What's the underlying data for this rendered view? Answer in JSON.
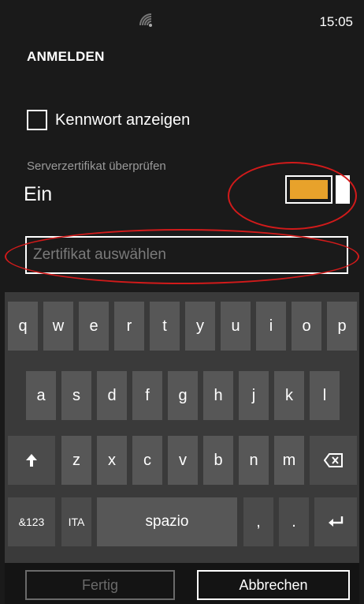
{
  "status": {
    "time": "15:05",
    "signal_icon": "wifi-signal-icon"
  },
  "page": {
    "title": "ANMELDEN"
  },
  "show_password": {
    "label": "Kennwort anzeigen",
    "checked": false
  },
  "server_cert": {
    "label": "Serverzertifikat überprüfen",
    "state": "Ein",
    "toggle_on": true,
    "accent": "#e8a22b"
  },
  "cert_field": {
    "placeholder": "Zertifikat auswählen",
    "value": ""
  },
  "keyboard": {
    "row1": [
      "q",
      "w",
      "e",
      "r",
      "t",
      "y",
      "u",
      "i",
      "o",
      "p"
    ],
    "row2": [
      "a",
      "s",
      "d",
      "f",
      "g",
      "h",
      "j",
      "k",
      "l"
    ],
    "row3": [
      "z",
      "x",
      "c",
      "v",
      "b",
      "n",
      "m"
    ],
    "shift_icon": "shift-arrow-icon",
    "backspace_icon": "backspace-icon",
    "symbols_label": "&123",
    "language_label": "ITA",
    "space_label": "spazio",
    "comma_label": ",",
    "period_label": ".",
    "enter_icon": "enter-icon"
  },
  "actions": {
    "done_label": "Fertig",
    "cancel_label": "Abbrechen"
  },
  "annotation_color": "#d21a1a"
}
